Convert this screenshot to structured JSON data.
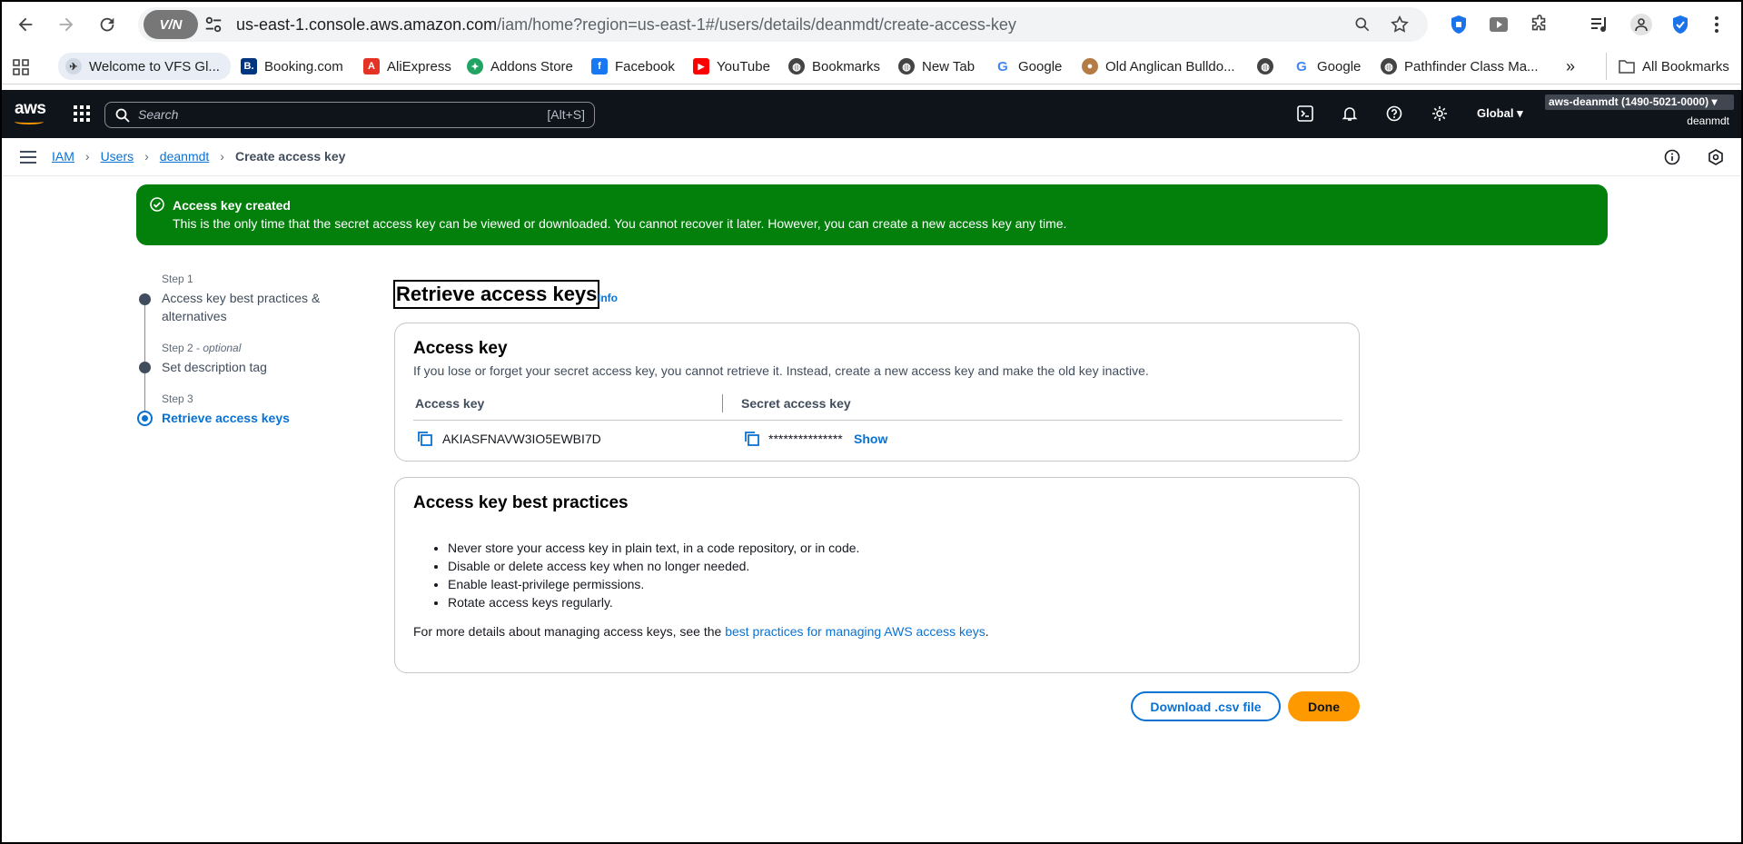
{
  "browser": {
    "url_host": "us-east-1.console.aws.amazon.com",
    "url_path": "/iam/home?region=us-east-1#/users/details/deanmdt/create-access-key",
    "vpn_label": "V/N",
    "bookmarks": [
      {
        "label": "Welcome to VFS Gl...",
        "icon": "vfs-icon"
      },
      {
        "label": "Booking.com",
        "icon": "booking-icon",
        "color": "#003580",
        "glyph": "B."
      },
      {
        "label": "AliExpress",
        "icon": "aliexpress-icon",
        "color": "#e43225",
        "glyph": "A"
      },
      {
        "label": "Addons Store",
        "icon": "addons-icon",
        "color": "#20a464",
        "glyph": "✦"
      },
      {
        "label": "Facebook",
        "icon": "facebook-icon",
        "color": "#1877f2",
        "glyph": "f"
      },
      {
        "label": "YouTube",
        "icon": "youtube-icon",
        "color": "#ff0000",
        "glyph": "▶"
      },
      {
        "label": "Bookmarks",
        "icon": "globe-icon"
      },
      {
        "label": "New Tab",
        "icon": "globe-icon"
      },
      {
        "label": "Google",
        "icon": "google-icon"
      },
      {
        "label": "Old Anglican Bulldo...",
        "icon": "dog-icon"
      },
      {
        "label": "",
        "icon": "globe-icon"
      },
      {
        "label": "Google",
        "icon": "google-icon"
      },
      {
        "label": "Pathfinder Class Ma...",
        "icon": "globe-icon"
      }
    ],
    "all_bookmarks": "All Bookmarks"
  },
  "aws": {
    "logo": "aws",
    "search_placeholder": "Search",
    "search_shortcut": "[Alt+S]",
    "region": "Global",
    "account": "aws-deanmdt (1490-5021-0000)",
    "username": "deanmdt"
  },
  "breadcrumb": {
    "items": [
      "IAM",
      "Users",
      "deanmdt"
    ],
    "current": "Create access key"
  },
  "flash": {
    "title": "Access key created",
    "message": "This is the only time that the secret access key can be viewed or downloaded. You cannot recover it later. However, you can create a new access key any time."
  },
  "steps": [
    {
      "label": "Step 1",
      "optional": "",
      "name": "Access key best practices & alternatives"
    },
    {
      "label": "Step 2 - ",
      "optional": "optional",
      "name": "Set description tag"
    },
    {
      "label": "Step 3",
      "optional": "",
      "name": "Retrieve access keys"
    }
  ],
  "main": {
    "title": "Retrieve access keys",
    "info": "Info",
    "access_key_card": {
      "title": "Access key",
      "description": "If you lose or forget your secret access key, you cannot retrieve it. Instead, create a new access key and make the old key inactive.",
      "col_access_key": "Access key",
      "col_secret": "Secret access key",
      "access_key_value": "AKIASFNAVW3IO5EWBI7D",
      "secret_value": "***************",
      "show_label": "Show"
    },
    "best_practices_card": {
      "title": "Access key best practices",
      "items": [
        "Never store your access key in plain text, in a code repository, or in code.",
        "Disable or delete access key when no longer needed.",
        "Enable least-privilege permissions.",
        "Rotate access keys regularly."
      ],
      "more_prefix": "For more details about managing access keys, see the ",
      "more_link": "best practices for managing AWS access keys",
      "more_suffix": "."
    },
    "download_label": "Download .csv file",
    "done_label": "Done"
  }
}
